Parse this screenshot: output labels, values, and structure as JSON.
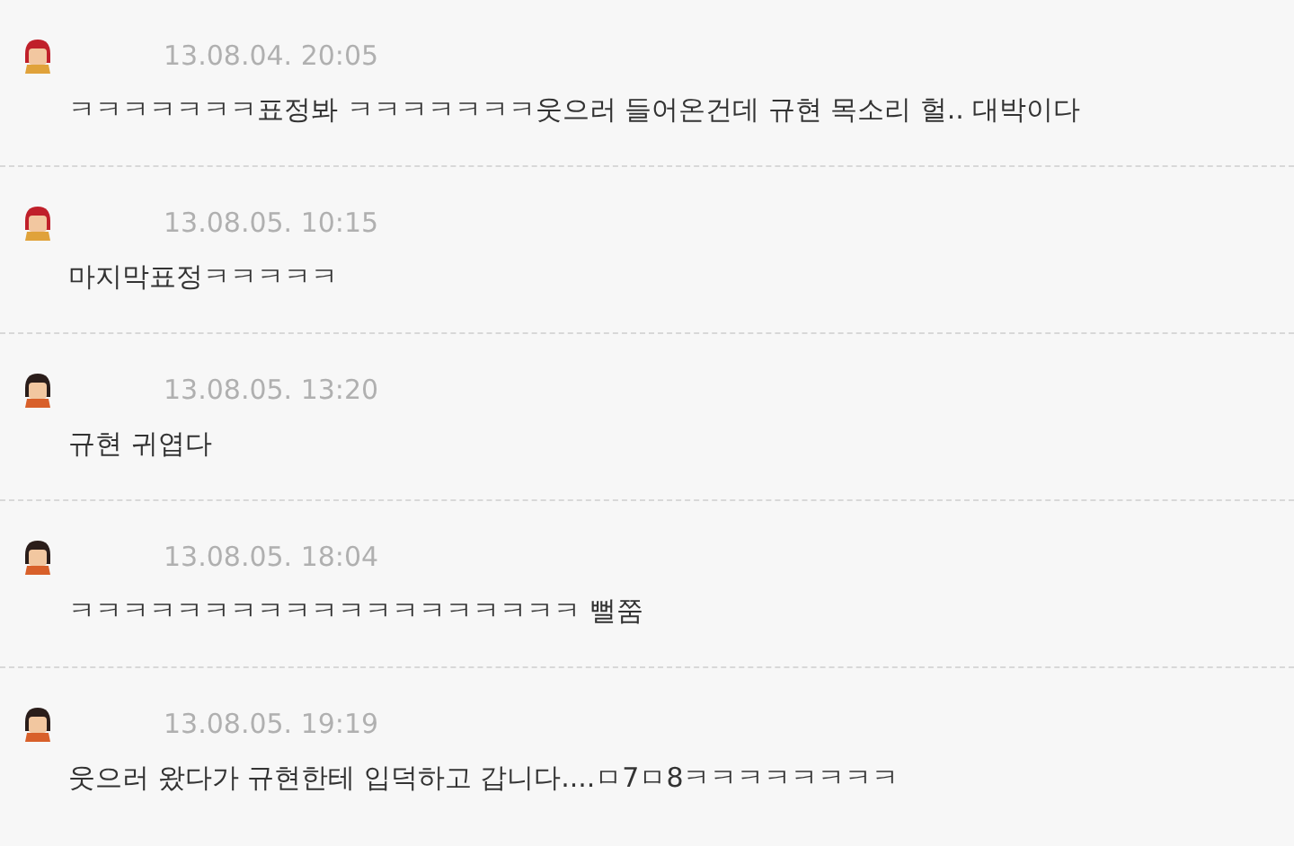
{
  "comments": [
    {
      "kind": "red",
      "time": "13.08.04. 20:05",
      "text": "ㅋㅋㅋㅋㅋㅋㅋ표정봐 ㅋㅋㅋㅋㅋㅋㅋ웃으러 들어온건데 규현 목소리 헐.. 대박이다"
    },
    {
      "kind": "red",
      "time": "13.08.05. 10:15",
      "text": "마지막표정ㅋㅋㅋㅋㅋ"
    },
    {
      "kind": "dark",
      "time": "13.08.05. 13:20",
      "text": "규현 귀엽다"
    },
    {
      "kind": "dark",
      "time": "13.08.05. 18:04",
      "text": "ㅋㅋㅋㅋㅋㅋㅋㅋㅋㅋㅋㅋㅋㅋㅋㅋㅋㅋㅋ 뻘쭘"
    },
    {
      "kind": "dark",
      "time": "13.08.05. 19:19",
      "text": "웃으러 왔다가 규현한테 입덕하고 갑니다....ㅁ7ㅁ8ㅋㅋㅋㅋㅋㅋㅋㅋ"
    }
  ]
}
